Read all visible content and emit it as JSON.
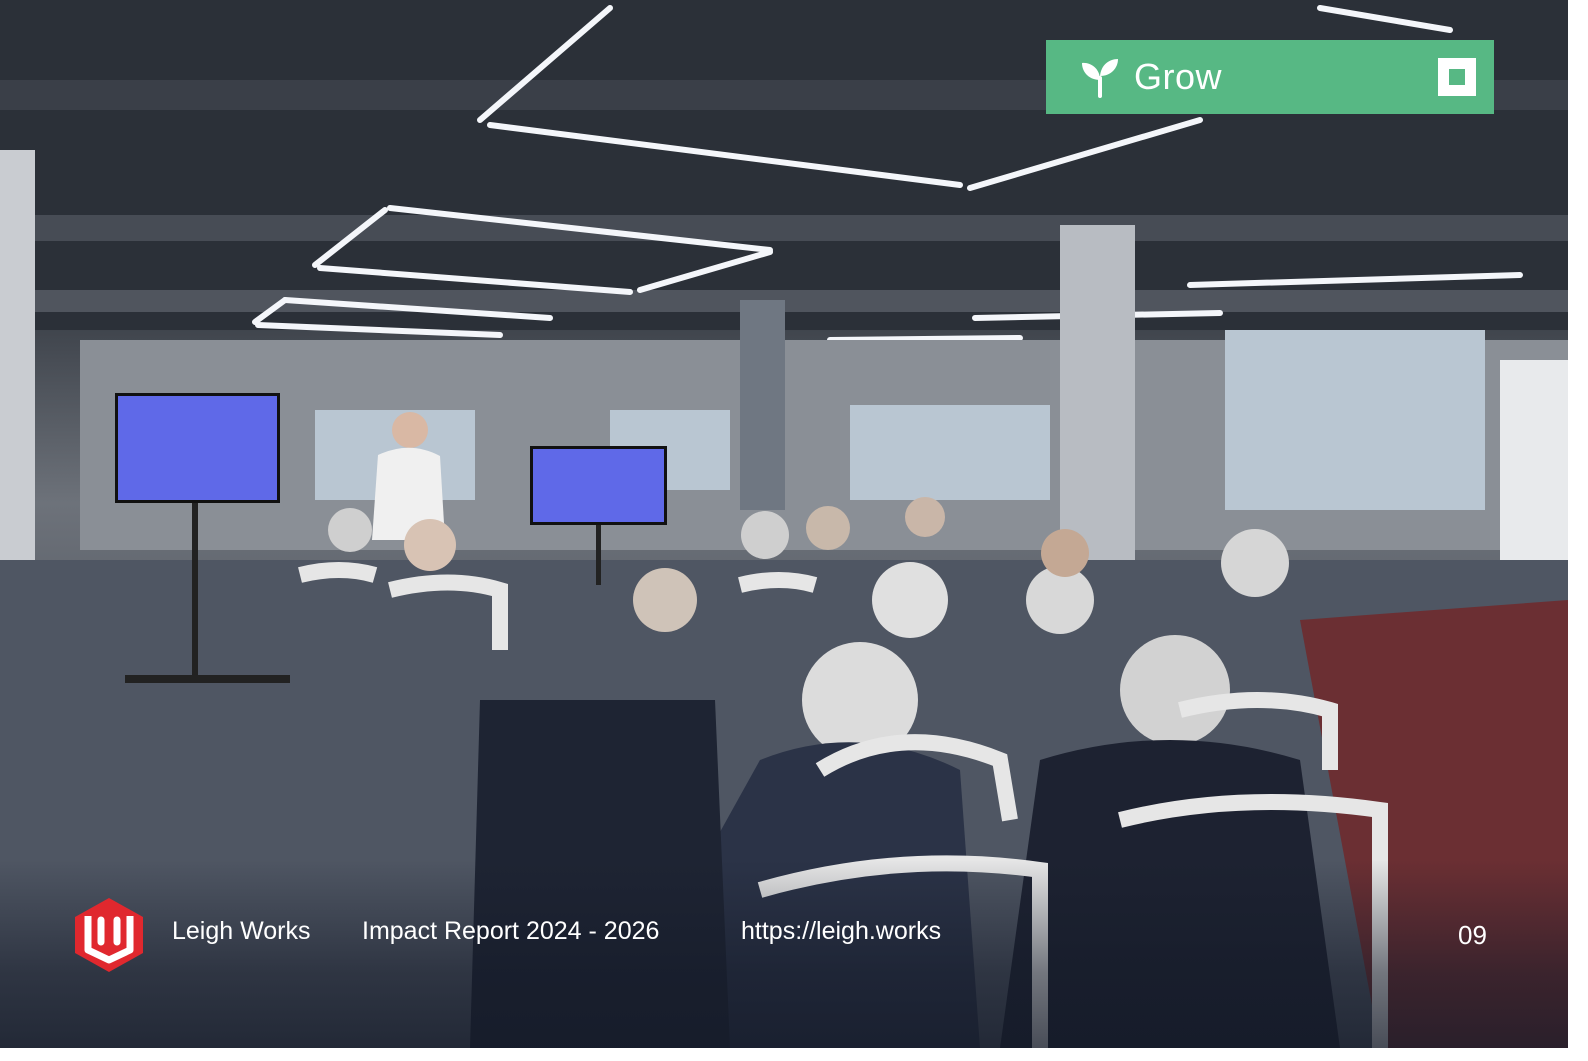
{
  "badge": {
    "label": "Grow",
    "icon": "sprout-icon",
    "color": "#57b884",
    "toggle_icon": "square-icon"
  },
  "footer": {
    "logo": "leigh-works-logo",
    "logo_color": "#e0282e",
    "organization": "Leigh Works",
    "report_title": "Impact Report 2024 - 2026",
    "url": "https://leigh.works",
    "page_number": "09"
  },
  "photo": {
    "subject": "audience-seated-facing-presenter",
    "screen_color": "#5f69e8"
  }
}
